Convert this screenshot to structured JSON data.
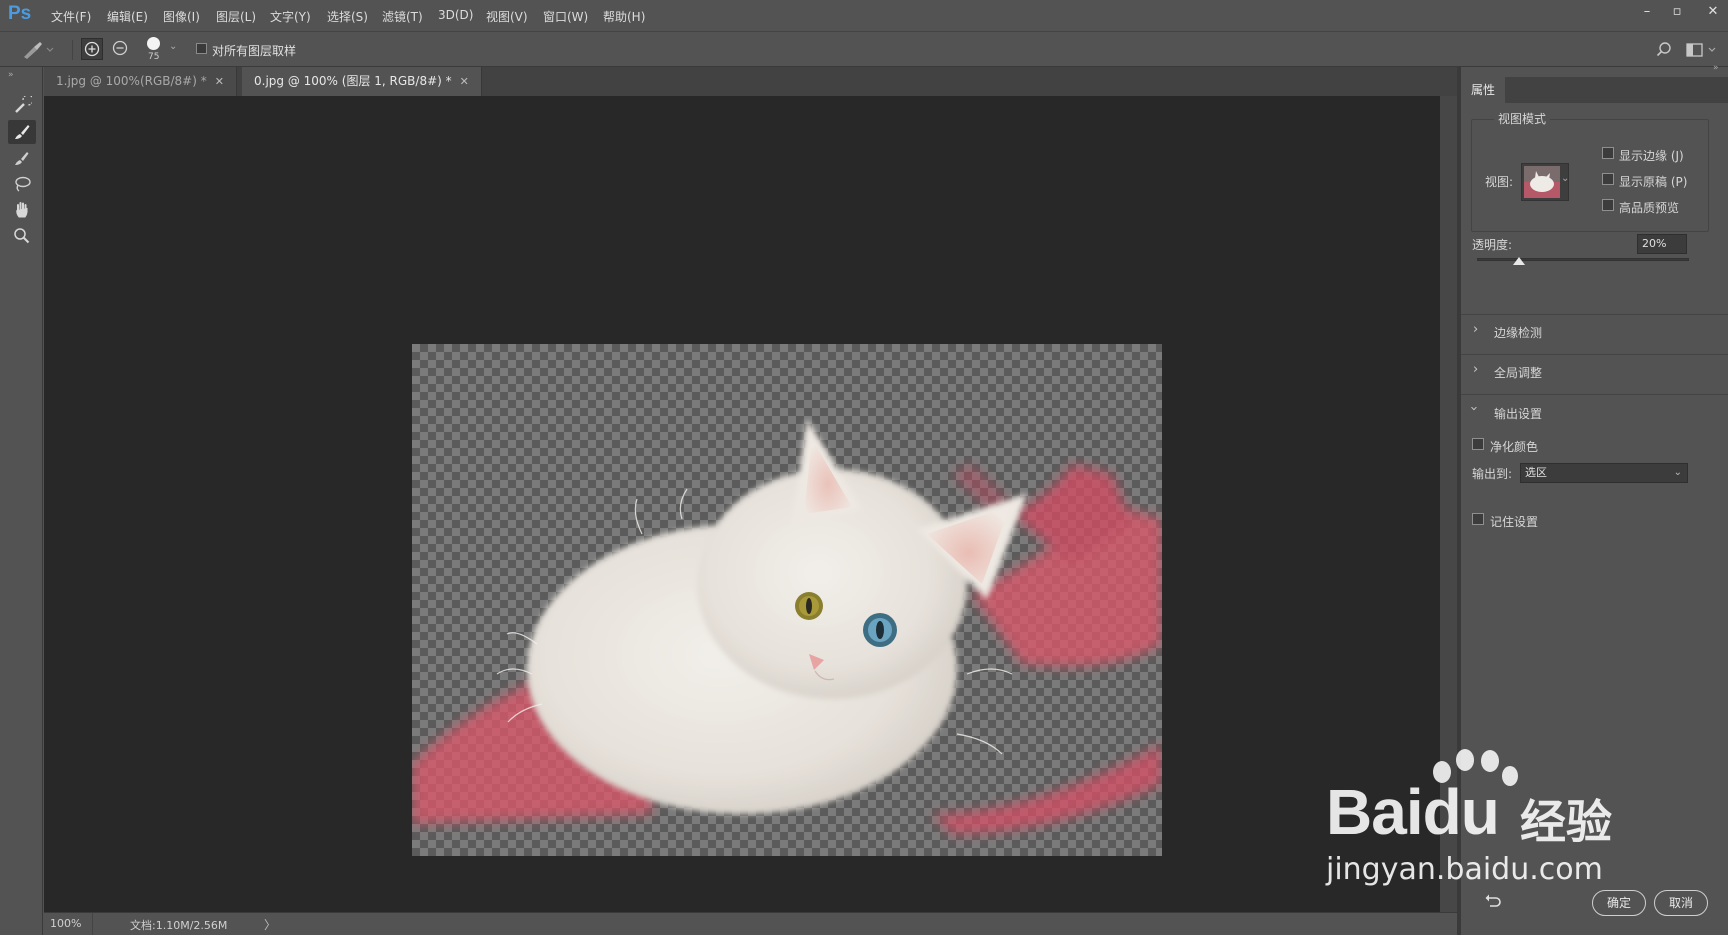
{
  "app": {
    "logo": "Ps"
  },
  "menu": [
    "文件(F)",
    "编辑(E)",
    "图像(I)",
    "图层(L)",
    "文字(Y)",
    "选择(S)",
    "滤镜(T)",
    "3D(D)",
    "视图(V)",
    "窗口(W)",
    "帮助(H)"
  ],
  "window_controls": {
    "minimize": "–",
    "restore": "▫",
    "close": "✕"
  },
  "options": {
    "brush_size": "75",
    "sample_all_layers_label": "对所有图层取样",
    "sample_all_layers_checked": false
  },
  "tabs": [
    {
      "label": "1.jpg @ 100%(RGB/8#) *",
      "active": false
    },
    {
      "label": "0.jpg @ 100% (图层 1, RGB/8#) *",
      "active": true
    }
  ],
  "status": {
    "zoom": "100%",
    "doc": "文档:1.10M/2.56M",
    "arrow": "〉"
  },
  "panel": {
    "tab": "属性",
    "view_mode": {
      "title": "视图模式",
      "view_label": "视图:",
      "show_edge": {
        "label": "显示边缘 (J)",
        "checked": false
      },
      "show_original": {
        "label": "显示原稿 (P)",
        "checked": false
      },
      "high_quality": {
        "label": "高品质预览",
        "checked": false
      }
    },
    "opacity": {
      "label": "透明度:",
      "value": "20%",
      "fraction": 0.2
    },
    "sections": [
      {
        "label": "边缘检测",
        "expanded": false
      },
      {
        "label": "全局调整",
        "expanded": false
      },
      {
        "label": "输出设置",
        "expanded": true
      }
    ],
    "decontaminate": {
      "label": "净化颜色",
      "checked": false
    },
    "output_to": {
      "label": "输出到:",
      "value": "选区"
    },
    "remember": {
      "label": "记住设置",
      "checked": false
    },
    "ok": "确定",
    "cancel": "取消"
  },
  "watermark": {
    "bai": "Bai",
    "du": "du",
    "cn": "经验",
    "url": "jingyan.baidu.com"
  },
  "colors": {
    "accent": "#4a9be2",
    "overlay": "#e0566b"
  }
}
